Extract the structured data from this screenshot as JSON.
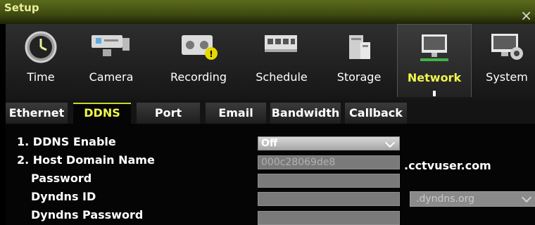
{
  "window": {
    "title": "Setup",
    "close_glyph": "×"
  },
  "toolbar": {
    "items": [
      {
        "label": "Time",
        "icon": "clock-icon",
        "active": false
      },
      {
        "label": "Camera",
        "icon": "camera-icon",
        "active": false
      },
      {
        "label": "Recording",
        "icon": "recording-icon",
        "active": false
      },
      {
        "label": "Schedule",
        "icon": "schedule-icon",
        "active": false
      },
      {
        "label": "Storage",
        "icon": "storage-icon",
        "active": false
      },
      {
        "label": "Network",
        "icon": "network-monitor-icon",
        "active": true
      },
      {
        "label": "System",
        "icon": "system-gear-icon",
        "active": false
      }
    ]
  },
  "tabs": [
    {
      "label": "Ethernet",
      "active": false
    },
    {
      "label": "DDNS",
      "active": true
    },
    {
      "label": "Port",
      "active": false
    },
    {
      "label": "Email",
      "active": false
    },
    {
      "label": "Bandwidth",
      "active": false
    },
    {
      "label": "Callback",
      "active": false
    }
  ],
  "form": {
    "ddns_enable": {
      "label": "1. DDNS Enable",
      "value": "Off"
    },
    "host_domain": {
      "label": "2. Host Domain Name",
      "value": "000c28069de8",
      "suffix": ".cctvuser.com"
    },
    "password": {
      "label": "Password",
      "value": ""
    },
    "dyndns_id": {
      "label": "Dyndns ID",
      "value": "",
      "domain_option": ".dyndns.org"
    },
    "dyndns_password": {
      "label": "Dyndns Password",
      "value": ""
    }
  },
  "colors": {
    "active_text": "#f0f64a",
    "title_bar": "#404b10"
  }
}
